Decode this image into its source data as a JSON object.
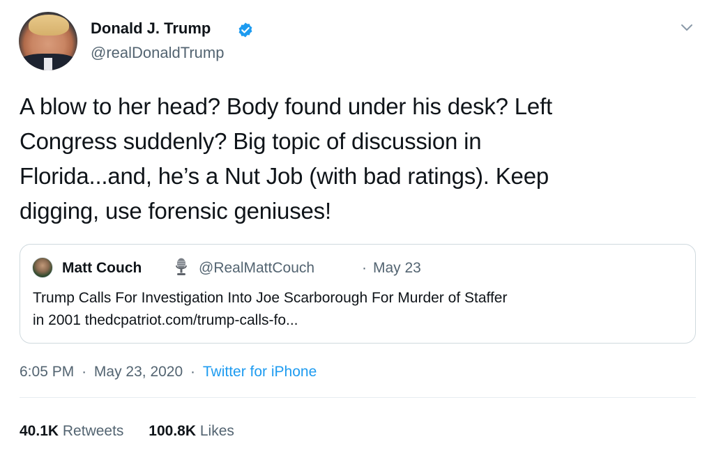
{
  "author": {
    "name": "Donald J. Trump",
    "handle": "@realDonaldTrump",
    "verified": true
  },
  "tweet": {
    "text": "A blow to her head? Body found under his desk? Left\nCongress suddenly? Big topic of discussion in\nFlorida...and, he’s a Nut Job (with bad ratings). Keep\ndigging, use forensic geniuses!"
  },
  "quoted_tweet": {
    "name": "Matt Couch",
    "badge_icon": "microphone-icon",
    "handle": "@RealMattCouch",
    "separator": "·",
    "date": "May 23",
    "text": "Trump Calls For Investigation Into Joe Scarborough For Murder of Staffer\nin 2001 thedcpatriot.com/trump-calls-fo..."
  },
  "meta": {
    "time": "6:05 PM",
    "separator": "·",
    "date": "May 23, 2020",
    "source": "Twitter for iPhone"
  },
  "stats": {
    "retweets_value": "40.1K",
    "retweets_label": "Retweets",
    "likes_value": "100.8K",
    "likes_label": "Likes"
  },
  "colors": {
    "link": "#1d9bf0",
    "secondary_text": "#536471",
    "verified_badge": "#1d9bf0",
    "border": "#cfd9de"
  }
}
